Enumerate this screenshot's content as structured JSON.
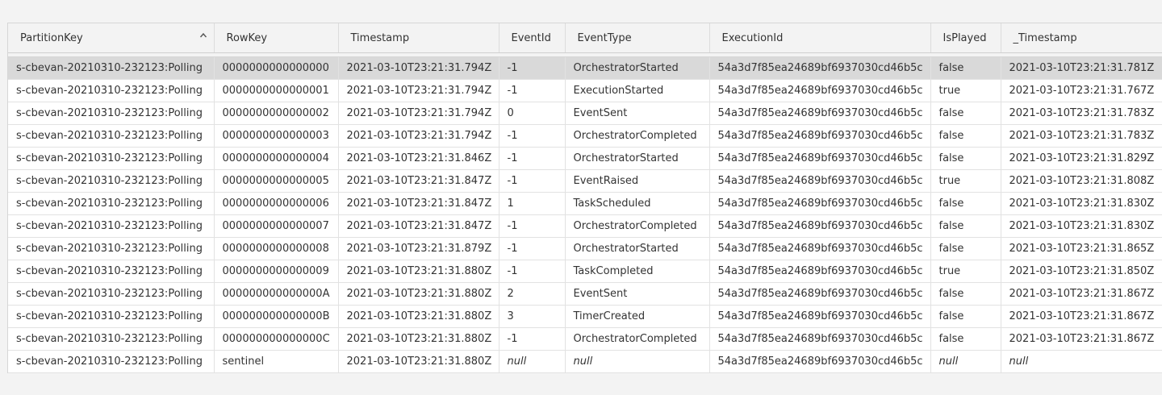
{
  "table": {
    "columns": [
      "PartitionKey",
      "RowKey",
      "Timestamp",
      "EventId",
      "EventType",
      "ExecutionId",
      "IsPlayed",
      "_Timestamp"
    ],
    "sort": {
      "column": "PartitionKey",
      "direction": "ascending",
      "icon": "chevron-up-icon"
    },
    "selected_row_index": 0,
    "rows": [
      [
        "s-cbevan-20210310-232123:Polling",
        "0000000000000000",
        "2021-03-10T23:21:31.794Z",
        "-1",
        "OrchestratorStarted",
        "54a3d7f85ea24689bf6937030cd46b5c",
        "false",
        "2021-03-10T23:21:31.781Z"
      ],
      [
        "s-cbevan-20210310-232123:Polling",
        "0000000000000001",
        "2021-03-10T23:21:31.794Z",
        "-1",
        "ExecutionStarted",
        "54a3d7f85ea24689bf6937030cd46b5c",
        "true",
        "2021-03-10T23:21:31.767Z"
      ],
      [
        "s-cbevan-20210310-232123:Polling",
        "0000000000000002",
        "2021-03-10T23:21:31.794Z",
        "0",
        "EventSent",
        "54a3d7f85ea24689bf6937030cd46b5c",
        "false",
        "2021-03-10T23:21:31.783Z"
      ],
      [
        "s-cbevan-20210310-232123:Polling",
        "0000000000000003",
        "2021-03-10T23:21:31.794Z",
        "-1",
        "OrchestratorCompleted",
        "54a3d7f85ea24689bf6937030cd46b5c",
        "false",
        "2021-03-10T23:21:31.783Z"
      ],
      [
        "s-cbevan-20210310-232123:Polling",
        "0000000000000004",
        "2021-03-10T23:21:31.846Z",
        "-1",
        "OrchestratorStarted",
        "54a3d7f85ea24689bf6937030cd46b5c",
        "false",
        "2021-03-10T23:21:31.829Z"
      ],
      [
        "s-cbevan-20210310-232123:Polling",
        "0000000000000005",
        "2021-03-10T23:21:31.847Z",
        "-1",
        "EventRaised",
        "54a3d7f85ea24689bf6937030cd46b5c",
        "true",
        "2021-03-10T23:21:31.808Z"
      ],
      [
        "s-cbevan-20210310-232123:Polling",
        "0000000000000006",
        "2021-03-10T23:21:31.847Z",
        "1",
        "TaskScheduled",
        "54a3d7f85ea24689bf6937030cd46b5c",
        "false",
        "2021-03-10T23:21:31.830Z"
      ],
      [
        "s-cbevan-20210310-232123:Polling",
        "0000000000000007",
        "2021-03-10T23:21:31.847Z",
        "-1",
        "OrchestratorCompleted",
        "54a3d7f85ea24689bf6937030cd46b5c",
        "false",
        "2021-03-10T23:21:31.830Z"
      ],
      [
        "s-cbevan-20210310-232123:Polling",
        "0000000000000008",
        "2021-03-10T23:21:31.879Z",
        "-1",
        "OrchestratorStarted",
        "54a3d7f85ea24689bf6937030cd46b5c",
        "false",
        "2021-03-10T23:21:31.865Z"
      ],
      [
        "s-cbevan-20210310-232123:Polling",
        "0000000000000009",
        "2021-03-10T23:21:31.880Z",
        "-1",
        "TaskCompleted",
        "54a3d7f85ea24689bf6937030cd46b5c",
        "true",
        "2021-03-10T23:21:31.850Z"
      ],
      [
        "s-cbevan-20210310-232123:Polling",
        "000000000000000A",
        "2021-03-10T23:21:31.880Z",
        "2",
        "EventSent",
        "54a3d7f85ea24689bf6937030cd46b5c",
        "false",
        "2021-03-10T23:21:31.867Z"
      ],
      [
        "s-cbevan-20210310-232123:Polling",
        "000000000000000B",
        "2021-03-10T23:21:31.880Z",
        "3",
        "TimerCreated",
        "54a3d7f85ea24689bf6937030cd46b5c",
        "false",
        "2021-03-10T23:21:31.867Z"
      ],
      [
        "s-cbevan-20210310-232123:Polling",
        "000000000000000C",
        "2021-03-10T23:21:31.880Z",
        "-1",
        "OrchestratorCompleted",
        "54a3d7f85ea24689bf6937030cd46b5c",
        "false",
        "2021-03-10T23:21:31.867Z"
      ],
      [
        "s-cbevan-20210310-232123:Polling",
        "sentinel",
        "2021-03-10T23:21:31.880Z",
        "null",
        "null",
        "54a3d7f85ea24689bf6937030cd46b5c",
        "null",
        "null"
      ]
    ]
  },
  "colors": {
    "page_background": "#f3f3f3",
    "selected_row": "#d9d9d9",
    "grid_line": "#e2e2e2"
  }
}
